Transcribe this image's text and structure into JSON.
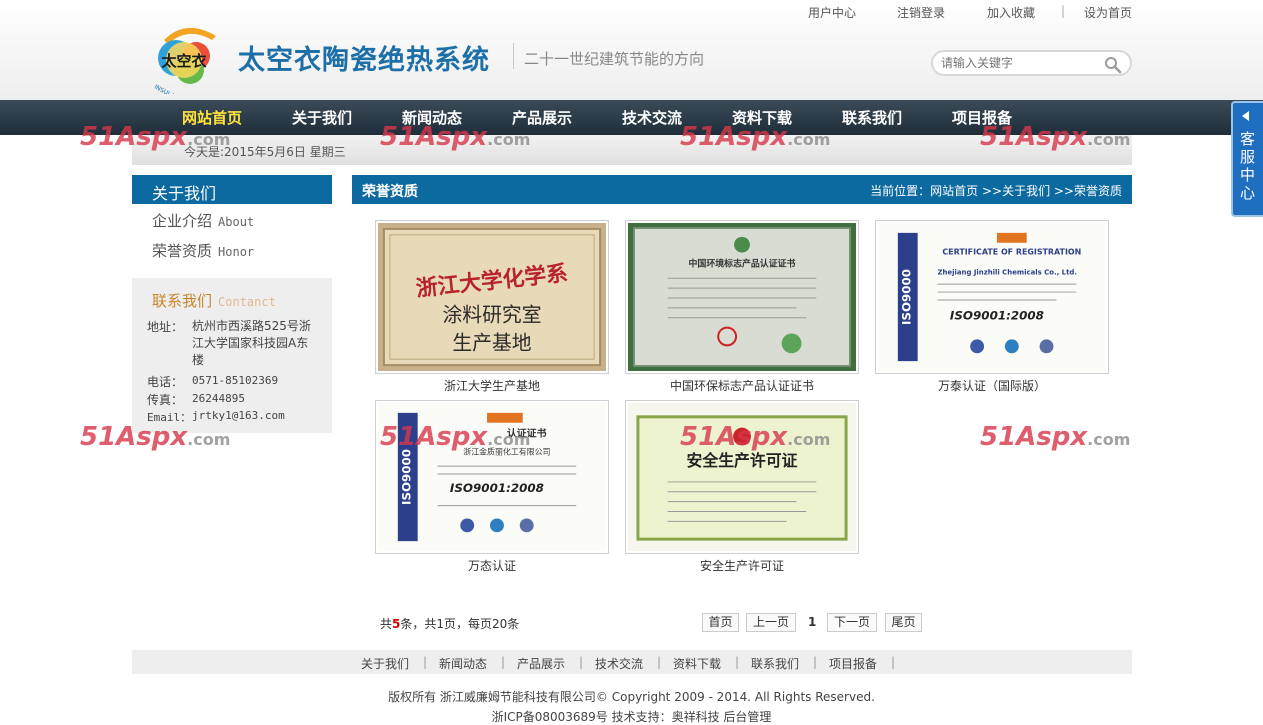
{
  "toplinks": [
    "用户中心",
    "注销登录",
    "加入收藏",
    "|",
    "设为首页"
  ],
  "header": {
    "logo_text": "太空衣",
    "logo_ring": "INSULATING CERAMICS",
    "title": "太空衣陶瓷绝热系统",
    "slogan": "二十一世纪建筑节能的方向",
    "search_placeholder": "请输入关键字"
  },
  "nav": [
    "网站首页",
    "关于我们",
    "新闻动态",
    "产品展示",
    "技术交流",
    "资料下载",
    "联系我们",
    "项目报备"
  ],
  "datebar": "今天是:2015年5月6日  星期三",
  "sidebar": {
    "title": "关于我们",
    "items": [
      {
        "label": "企业介绍",
        "en": "About"
      },
      {
        "label": "荣誉资质",
        "en": "Honor"
      }
    ],
    "contact": {
      "title": "联系我们",
      "title_en": "Contanct",
      "address_label": "地址：",
      "address": "杭州市西溪路525号浙江大学国家科技园A东楼",
      "phone_label": "电话：",
      "phone": "0571-85102369",
      "fax_label": "传真：",
      "fax": "26244895",
      "email_label": "Email：",
      "email": "jrtky1@163.com"
    }
  },
  "main": {
    "title": "荣誉资质",
    "breadcrumb": "当前位置：网站首页 >>关于我们 >>荣誉资质",
    "items": [
      {
        "caption": "浙江大学生产基地",
        "plaque_line1": "浙江大学化学系",
        "plaque_line2": "涂料研究室",
        "plaque_line3": "生产基地"
      },
      {
        "caption": "中国环保标志产品认证证书",
        "cert_title": "中国环境标志产品认证证书"
      },
      {
        "caption": "万泰认证（国际版）",
        "cert_title": "CERTIFICATE OF REGISTRATION",
        "cert_company": "Zhejiang Jinzhili Chemicals Co., Ltd.",
        "iso": "ISO9001:2008",
        "side": "ISO9000"
      },
      {
        "caption": "万态认证",
        "cert_title": "认证证书",
        "cert_company": "浙江金质丽化工有限公司",
        "iso": "ISO9001:2008",
        "side": "ISO9000"
      },
      {
        "caption": "安全生产许可证",
        "cert_title": "安全生产许可证"
      }
    ]
  },
  "pagination": {
    "prefix": "共",
    "count": "5",
    "suffix": "条，共1页，每页20条",
    "first": "首页",
    "prev": "上一页",
    "current": "1",
    "next": "下一页",
    "last": "尾页"
  },
  "footer": {
    "links": [
      "关于我们",
      "|",
      "新闻动态",
      "|",
      "产品展示",
      "|",
      "技术交流",
      "|",
      "资料下载",
      "|",
      "联系我们",
      "|",
      "项目报备",
      "|"
    ],
    "copyright": "版权所有 浙江威廉姆节能科技有限公司© Copyright 2009 - 2014. All Rights Reserved.",
    "icp": "浙ICP备08003689号 技术支持：奥祥科技 后台管理"
  },
  "service_tab": "客服中心",
  "watermark": {
    "a": "51Aspx",
    "b": ".com"
  },
  "colors": {
    "brand_blue": "#0d6aa0",
    "nav_dark": "#2b3a47",
    "nav_active": "#ffe33b",
    "contact_orange": "#c8862b"
  }
}
